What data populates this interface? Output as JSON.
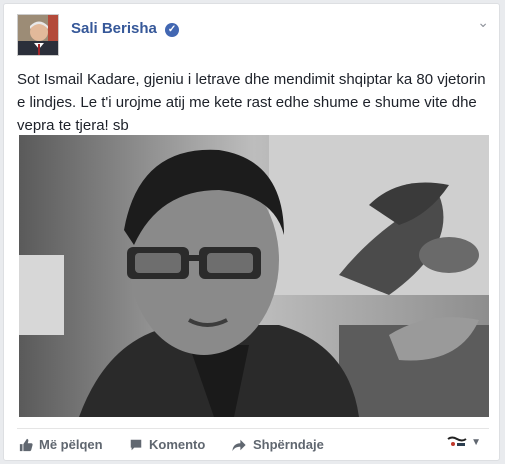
{
  "post": {
    "author": "Sali Berisha",
    "text": "Sot Ismail Kadare, gjeniu i letrave dhe mendimit shqiptar ka 80 vjetorin e lindjes. Le t'i urojme atij me kete rast edhe shume e shume vite dhe vepra te tjera! sb"
  },
  "actions": {
    "like": "Më pëlqen",
    "comment": "Komento",
    "share": "Shpërndaje"
  },
  "icons": {
    "verified": "verified-badge-icon",
    "chevron": "chevron-down-icon",
    "like": "thumbs-up-icon",
    "comment": "comment-bubble-icon",
    "share": "share-arrow-icon"
  },
  "colors": {
    "author": "#365899",
    "verified": "#4267b2",
    "action_text": "#606770"
  }
}
